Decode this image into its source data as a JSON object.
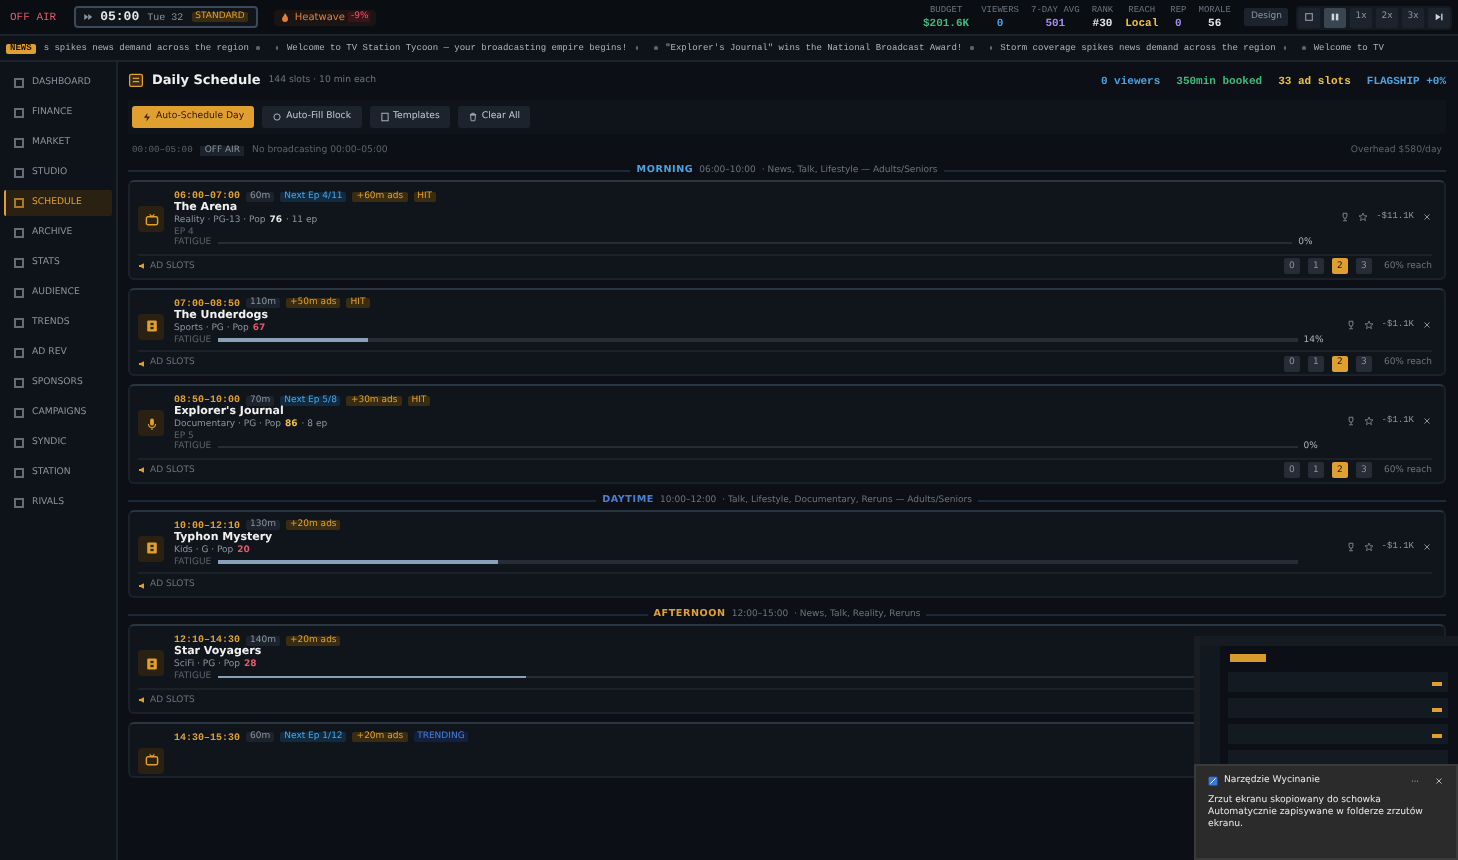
{
  "top_bar": {
    "status": "OFF AIR",
    "clock": {
      "time": "05:00",
      "day": "Tue 32",
      "mode": "STANDARD"
    },
    "weather": {
      "label": "Heatwave",
      "badge": "-9%"
    },
    "stats": [
      {
        "label": "BUDGET",
        "value": "$201.6K",
        "color": "#3fb97a"
      },
      {
        "label": "VIEWERS",
        "value": "0",
        "color": "#4aa3e0"
      },
      {
        "label": "7-DAY AVG",
        "value": "501",
        "color": "#a58cf0"
      },
      {
        "label": "RANK",
        "value": "#30",
        "color": "#e6e6e6"
      },
      {
        "label": "REACH",
        "value": "Local",
        "color": "#f0c040"
      },
      {
        "label": "REP",
        "value": "0",
        "color": "#a58cf0"
      },
      {
        "label": "MORALE",
        "value": "56",
        "color": "#e6e6e6"
      }
    ],
    "design_button": "Design",
    "speeds": [
      {
        "kind": "grid",
        "selected": false
      },
      {
        "kind": "pause",
        "selected": true
      },
      {
        "kind": "text",
        "label": "1x",
        "selected": false
      },
      {
        "kind": "text",
        "label": "2x",
        "selected": false
      },
      {
        "kind": "text",
        "label": "3x",
        "selected": false
      },
      {
        "kind": "skip",
        "selected": false
      }
    ]
  },
  "ticker": {
    "badge": "NEWS",
    "items": [
      "s spikes news demand across the region",
      "Welcome to TV Station Tycoon — your broadcasting empire begins!",
      "\"Explorer's Journal\" wins the National Broadcast Award!",
      "Storm coverage spikes news demand across the region",
      "Welcome to TV"
    ]
  },
  "sidebar": {
    "items": [
      {
        "label": "DASHBOARD",
        "selected": false
      },
      {
        "label": "FINANCE",
        "selected": false
      },
      {
        "label": "MARKET",
        "selected": false
      },
      {
        "label": "STUDIO",
        "selected": false
      },
      {
        "label": "SCHEDULE",
        "selected": true
      },
      {
        "label": "ARCHIVE",
        "selected": false
      },
      {
        "label": "STATS",
        "selected": false
      },
      {
        "label": "AUDIENCE",
        "selected": false
      },
      {
        "label": "TRENDS",
        "selected": false
      },
      {
        "label": "AD REV",
        "selected": false
      },
      {
        "label": "SPONSORS",
        "selected": false
      },
      {
        "label": "CAMPAIGNS",
        "selected": false
      },
      {
        "label": "SYNDIC",
        "selected": false
      },
      {
        "label": "STATION",
        "selected": false
      },
      {
        "label": "RIVALS",
        "selected": false
      }
    ]
  },
  "schedule": {
    "title": "Daily Schedule",
    "subtitle": "144 slots · 10 min each",
    "summary": [
      {
        "text": "0 viewers",
        "color": "#4aa3e0"
      },
      {
        "text": "350min booked",
        "color": "#3fb97a"
      },
      {
        "text": "33 ad slots",
        "color": "#f0c040"
      },
      {
        "text": "FLAGSHIP +0%",
        "color": "#4aa3e0"
      }
    ],
    "buttons": [
      {
        "label": "Auto-Schedule Day",
        "kind": "primary"
      },
      {
        "label": "Auto-Fill Block",
        "kind": "default"
      },
      {
        "label": "Templates",
        "kind": "default"
      },
      {
        "label": "Clear All",
        "kind": "default"
      }
    ],
    "off_air": {
      "time": "00:00–05:00",
      "badge": "OFF AIR",
      "note": "No broadcasting 00:00–05:00",
      "overhead": "Overhead $580/day"
    },
    "blocks": [
      {
        "name": "MORNING",
        "color": "#4aa3e0",
        "hours": "06:00–10:00",
        "description": "· News, Talk, Lifestyle — Adults/Seniors",
        "slots": [
          {
            "kind": "reality",
            "time": "06:00–07:00",
            "tags": [
              {
                "text": "60m",
                "kind": "duration"
              },
              {
                "text": "Next Ep 4/11",
                "kind": "episode"
              },
              {
                "text": "+60m ads",
                "kind": "ads"
              },
              {
                "text": "HIT",
                "kind": "hit"
              }
            ],
            "title": "The Arena",
            "genre": "Reality · PG-13 · Pop",
            "pop": {
              "value": "76",
              "color": "#e6e6e6"
            },
            "episodes": "· 11 ep",
            "ep": "EP 4",
            "fatigue": {
              "label": "FATIGUE",
              "reading": "0%"
            },
            "cost": "-$11.1K",
            "ads": {
              "label": "AD SLOTS",
              "options": [
                {
                  "label": "0",
                  "selected": false
                },
                {
                  "label": "1",
                  "selected": false
                },
                {
                  "label": "2",
                  "selected": true
                },
                {
                  "label": "3",
                  "selected": false
                }
              ],
              "reach": "60% reach"
            }
          },
          {
            "kind": "sports",
            "time": "07:00–08:50",
            "tags": [
              {
                "text": "110m",
                "kind": "duration"
              },
              {
                "text": "+50m ads",
                "kind": "ads"
              },
              {
                "text": "HIT",
                "kind": "hit"
              }
            ],
            "title": "The Underdogs",
            "genre": "Sports · PG · Pop",
            "pop": {
              "value": "67",
              "color": "#e05a6a"
            },
            "fatigue": {
              "label": "FATIGUE",
              "level": 0.14,
              "reading": "14%"
            },
            "cost": "-$1.1K",
            "ads": {
              "label": "AD SLOTS",
              "options": [
                {
                  "label": "0",
                  "selected": false
                },
                {
                  "label": "1",
                  "selected": false
                },
                {
                  "label": "2",
                  "selected": true
                },
                {
                  "label": "3",
                  "selected": false
                }
              ],
              "reach": "60% reach"
            }
          },
          {
            "kind": "documentary",
            "time": "08:50–10:00",
            "tags": [
              {
                "text": "70m",
                "kind": "duration"
              },
              {
                "text": "Next Ep 5/8",
                "kind": "episode"
              },
              {
                "text": "+30m ads",
                "kind": "ads"
              },
              {
                "text": "HIT",
                "kind": "hit"
              }
            ],
            "title": "Explorer's Journal",
            "genre": "Documentary · PG · Pop",
            "pop": {
              "value": "86",
              "color": "#f0c040"
            },
            "episodes": "· 8 ep",
            "ep": "EP 5",
            "fatigue": {
              "label": "FATIGUE",
              "reading": "0%"
            },
            "cost": "-$1.1K",
            "ads": {
              "label": "AD SLOTS",
              "options": [
                {
                  "label": "0",
                  "selected": false
                },
                {
                  "label": "1",
                  "selected": false
                },
                {
                  "label": "2",
                  "selected": true
                },
                {
                  "label": "3",
                  "selected": false
                }
              ],
              "reach": "60% reach"
            }
          }
        ]
      },
      {
        "name": "DAYTIME",
        "color": "#4a7fd0",
        "hours": "10:00–12:00",
        "description": "· Talk, Lifestyle, Documentary, Reruns — Adults/Seniors",
        "slots": [
          {
            "kind": "kids",
            "time": "10:00–12:10",
            "tags": [
              {
                "text": "130m",
                "kind": "duration"
              },
              {
                "text": "+20m ads",
                "kind": "ads"
              }
            ],
            "title": "Typhon Mystery",
            "genre": "Kids · G · Pop",
            "pop": {
              "value": "20",
              "color": "#e05a6a"
            },
            "fatigue": {
              "label": "FATIGUE",
              "level": 0.26
            },
            "cost": "-$1.1K",
            "ads": {
              "label": "AD SLOTS"
            }
          }
        ]
      },
      {
        "name": "AFTERNOON",
        "color": "#e0a030",
        "hours": "12:00–15:00",
        "description": "· News, Talk, Reality, Reruns",
        "slots": [
          {
            "kind": "scifi",
            "time": "12:10–14:30",
            "tags": [
              {
                "text": "140m",
                "kind": "duration"
              },
              {
                "text": "+20m ads",
                "kind": "ads"
              }
            ],
            "title": "Star Voyagers",
            "genre": "SciFi · PG · Pop",
            "pop": {
              "value": "28",
              "color": "#e05a6a"
            },
            "fatigue": {
              "label": "FATIGUE",
              "level": 0.26
            },
            "ads": {
              "label": "AD SLOTS"
            }
          },
          {
            "kind": "reality",
            "time": "14:30–15:30",
            "tags": [
              {
                "text": "60m",
                "kind": "duration"
              },
              {
                "text": "Next Ep 1/12",
                "kind": "episode"
              },
              {
                "text": "+20m ads",
                "kind": "ads"
              },
              {
                "text": "TRENDING",
                "kind": "trending"
              }
            ]
          }
        ]
      }
    ]
  },
  "toast": {
    "app": "Narzędzie Wycinanie",
    "message": "Zrzut ekranu skopiowany do schowka",
    "detail": "Automatycznie zapisywane w folderze zrzutów ekranu."
  }
}
